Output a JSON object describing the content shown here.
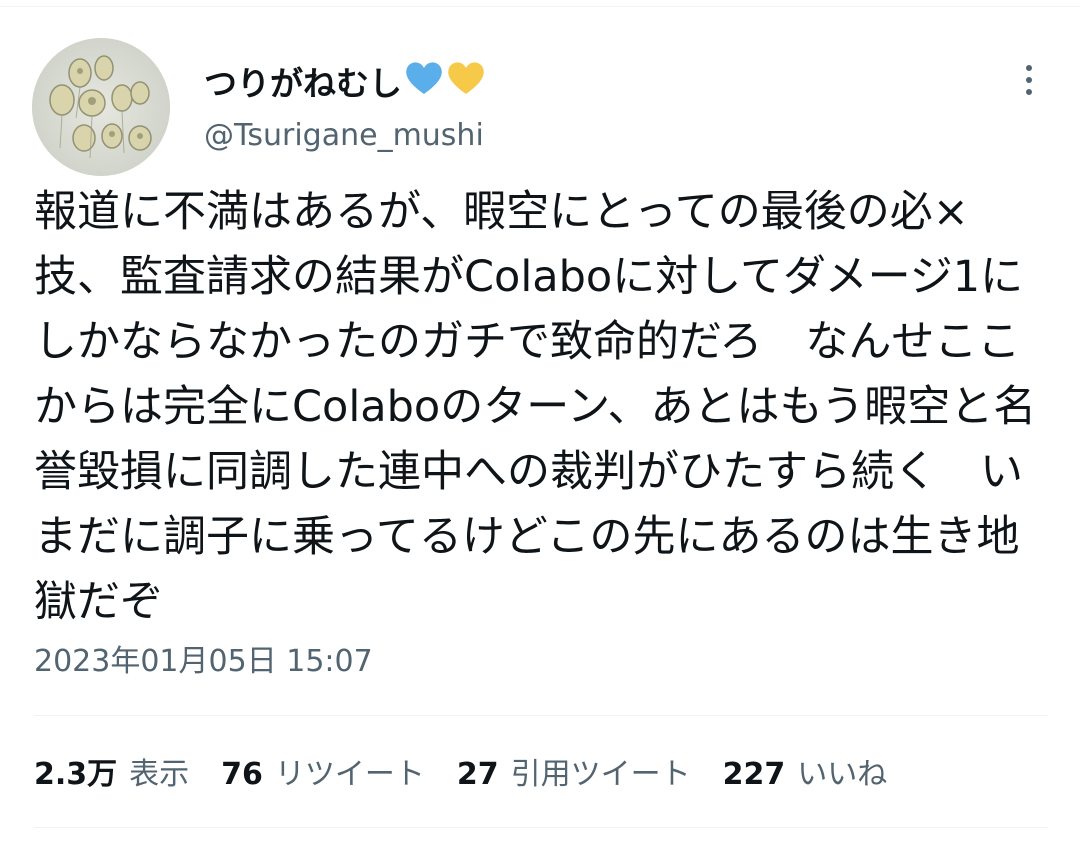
{
  "user": {
    "display_name": "つりがねむし",
    "hearts": [
      "blue-heart",
      "yellow-heart"
    ],
    "handle": "@Tsurigane_mushi"
  },
  "tweet": {
    "text": "報道に不満はあるが、暇空にとっての最後の必×技、監査請求の結果がColaboに対してダメージ1にしかならなかったのガチで致命的だろ　なんせここからは完全にColaboのターン、あとはもう暇空と名誉毀損に同調した連中への裁判がひたすら続く　いまだに調子に乗ってるけどこの先にあるのは生き地獄だぞ",
    "timestamp": "2023年01月05日 15:07"
  },
  "stats": {
    "views_count": "2.3万",
    "views_label": "表示",
    "retweets_count": "76",
    "retweets_label": "リツイート",
    "quotes_count": "27",
    "quotes_label": "引用ツイート",
    "likes_count": "227",
    "likes_label": "いいね"
  },
  "colors": {
    "text_primary": "#0f1419",
    "text_secondary": "#536471",
    "divider": "#eff3f4",
    "heart_blue": "#5aaeea",
    "heart_yellow": "#f7c948"
  },
  "icons": {
    "more": "more-vertical-icon"
  }
}
